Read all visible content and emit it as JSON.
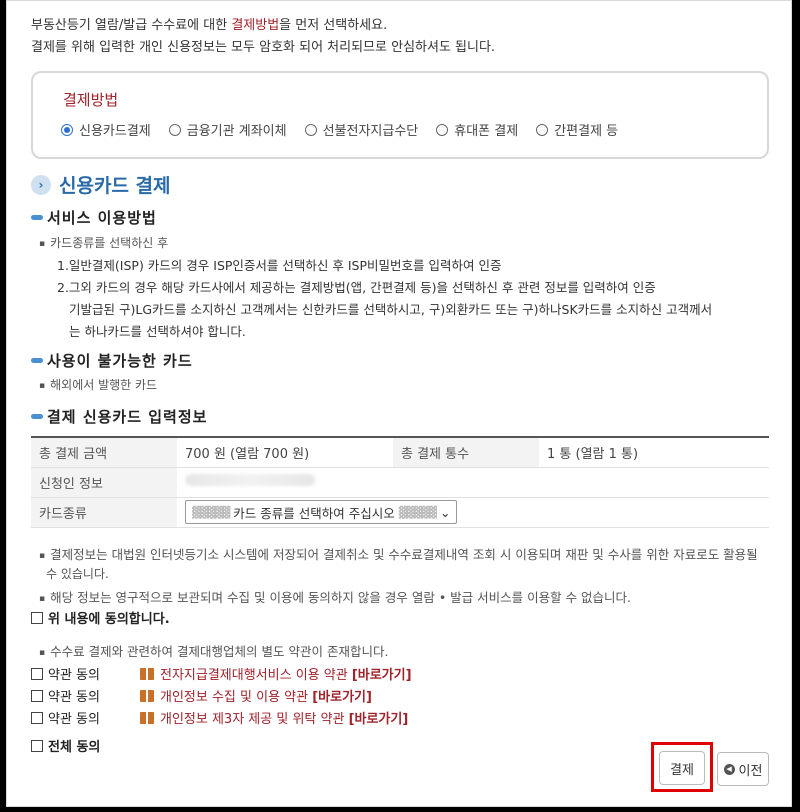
{
  "intro": {
    "line1_pre": "부동산등기 열람/발급 수수료에 대한 ",
    "line1_accent": "결제방법",
    "line1_post": "을 먼저 선택하세요.",
    "line2": "결제를 위해 입력한 개인 신용정보는 모두 암호화 되어 처리되므로 안심하셔도 됩니다."
  },
  "payment_methods": {
    "title": "결제방법",
    "options": [
      "신용카드결제",
      "금융기관 계좌이체",
      "선불전자지급수단",
      "휴대폰 결제",
      "간편결제 등"
    ],
    "selected": "신용카드결제"
  },
  "section_title": "신용카드 결제",
  "service_usage": {
    "title": "서비스 이용방법",
    "bullet": "카드종류를 선택하신 후",
    "item1": "1.일반결제(ISP) 카드의 경우 ISP인증서를 선택하신 후 ISP비밀번호를 입력하여 인증",
    "item2": "2.그외 카드의 경우 해당 카드사에서 제공하는 결제방법(앱, 간편결제 등)을 선택하신 후 관련 정보를 입력하여 인증",
    "note1": "기발급된 구)LG카드를 소지하신 고객께서는 신한카드를 선택하시고, 구)외환카드 또는 구)하나SK카드를 소지하신 고객께서",
    "note2": "는 하나카드를 선택하셔야 합니다."
  },
  "unavailable": {
    "title": "사용이 불가능한 카드",
    "bullet": "해외에서 발행한 카드"
  },
  "card_info": {
    "title": "결제 신용카드 입력정보",
    "total_label": "총 결제 금액",
    "total_value": "700 원 (열람 700 원)",
    "count_label": "총 결제 통수",
    "count_value": "1 통 (열람 1 통)",
    "applicant_label": "신청인 정보",
    "card_type_label": "카드종류",
    "card_type_placeholder": "카드 종류를 선택하여 주십시오"
  },
  "notices": {
    "n1_line1": "결제정보는 대법원 인터넷등기소 시스템에 저장되어 결제취소 및 수수료결제내역 조회 시 이용되며 재판 및 수사를 위한 자료로도 활용될",
    "n1_line2": "수 있습니다.",
    "n2": "해당 정보는 영구적으로 보관되며 수집 및 이용에 동의하지 않을 경우 열람 • 발급 서비스를 이용할 수 없습니다.",
    "agree": "위 내용에 동의합니다.",
    "n3": "수수료 결제와 관련하여 결제대행업체의 별도 약관이 존재합니다."
  },
  "terms": [
    {
      "check_label": "약관 동의",
      "name": "전자지급결제대행서비스 이용 약관",
      "link": "[바로가기]"
    },
    {
      "check_label": "약관 동의",
      "name": "개인정보 수집 및 이용 약관",
      "link": "[바로가기]"
    },
    {
      "check_label": "약관 동의",
      "name": "개인정보 제3자 제공 및 위탁 약관",
      "link": "[바로가기]"
    }
  ],
  "agree_all": "전체 동의",
  "buttons": {
    "pay": "결제",
    "prev": "이전"
  },
  "colors": {
    "accent": "#a0222a",
    "section_blue": "#2a6aa8",
    "highlight_red": "#e00000"
  }
}
